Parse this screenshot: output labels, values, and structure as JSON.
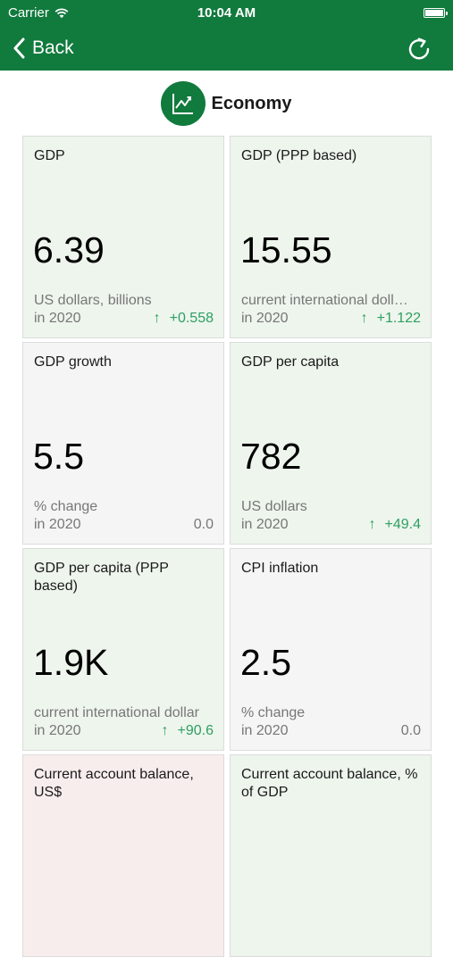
{
  "status_bar": {
    "carrier": "Carrier",
    "time": "10:04 AM"
  },
  "nav": {
    "back_label": "Back"
  },
  "section": {
    "title": "Economy",
    "icon": "line-chart-icon"
  },
  "cards": [
    {
      "title": "GDP",
      "value": "6.39",
      "unit": "US dollars, billions",
      "year": "in 2020",
      "change": "+0.558",
      "direction": "up",
      "tone": "positive"
    },
    {
      "title": "GDP (PPP based)",
      "value": "15.55",
      "unit": "current international doll…",
      "year": "in 2020",
      "change": "+1.122",
      "direction": "up",
      "tone": "positive"
    },
    {
      "title": "GDP growth",
      "value": "5.5",
      "unit": "% change",
      "year": "in 2020",
      "change": "0.0",
      "direction": "none",
      "tone": "neutral"
    },
    {
      "title": "GDP per capita",
      "value": "782",
      "unit": "US dollars",
      "year": "in 2020",
      "change": "+49.4",
      "direction": "up",
      "tone": "positive"
    },
    {
      "title": "GDP per capita (PPP based)",
      "value": "1.9K",
      "unit": "current international dollar",
      "year": "in 2020",
      "change": "+90.6",
      "direction": "up",
      "tone": "positive"
    },
    {
      "title": "CPI inflation",
      "value": "2.5",
      "unit": "% change",
      "year": "in 2020",
      "change": "0.0",
      "direction": "none",
      "tone": "neutral"
    },
    {
      "title": "Current account balance, US$",
      "value": "",
      "unit": "",
      "year": "",
      "change": "",
      "direction": "none",
      "tone": "negative"
    },
    {
      "title": "Current account balance, % of GDP",
      "value": "",
      "unit": "",
      "year": "",
      "change": "",
      "direction": "none",
      "tone": "positive"
    }
  ],
  "colors": {
    "brand_green": "#117a3d",
    "positive_bg": "#edf5ec",
    "negative_bg": "#f8eded",
    "neutral_bg": "#f5f5f5",
    "up_green": "#2e9f63"
  }
}
